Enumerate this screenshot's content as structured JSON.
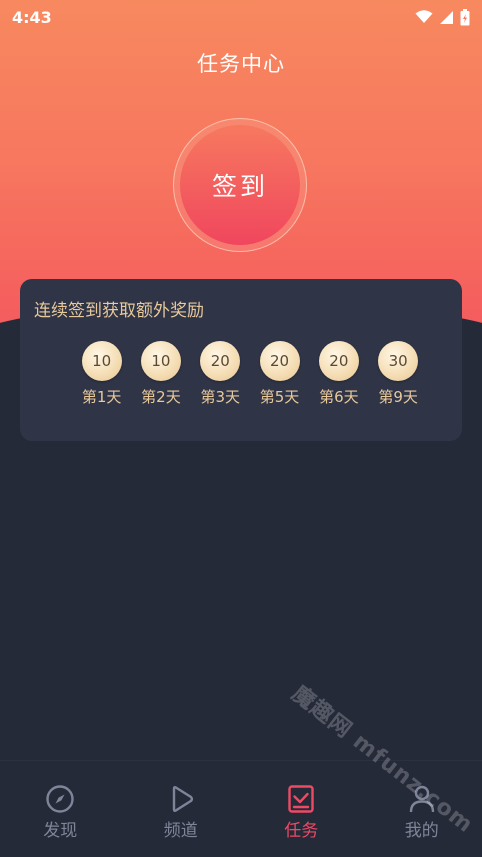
{
  "status_bar": {
    "time": "4:43"
  },
  "header": {
    "title": "任务中心"
  },
  "checkin": {
    "label": "签到"
  },
  "rewards": {
    "title": "连续签到获取额外奖励",
    "days": [
      {
        "amount": "10",
        "label": "第1天"
      },
      {
        "amount": "10",
        "label": "第2天"
      },
      {
        "amount": "20",
        "label": "第3天"
      },
      {
        "amount": "20",
        "label": "第5天"
      },
      {
        "amount": "20",
        "label": "第6天"
      },
      {
        "amount": "30",
        "label": "第9天"
      }
    ]
  },
  "nav": {
    "items": [
      {
        "label": "发现",
        "icon": "compass-icon"
      },
      {
        "label": "频道",
        "icon": "play-icon"
      },
      {
        "label": "任务",
        "icon": "task-check-icon",
        "active": true
      },
      {
        "label": "我的",
        "icon": "profile-icon"
      }
    ]
  },
  "watermark": {
    "text": "魔趣网 mfunz.com"
  },
  "colors": {
    "accent": "#ee4a64",
    "gold": "#e8c99b",
    "background": "#252a39",
    "card": "#2f3446"
  }
}
